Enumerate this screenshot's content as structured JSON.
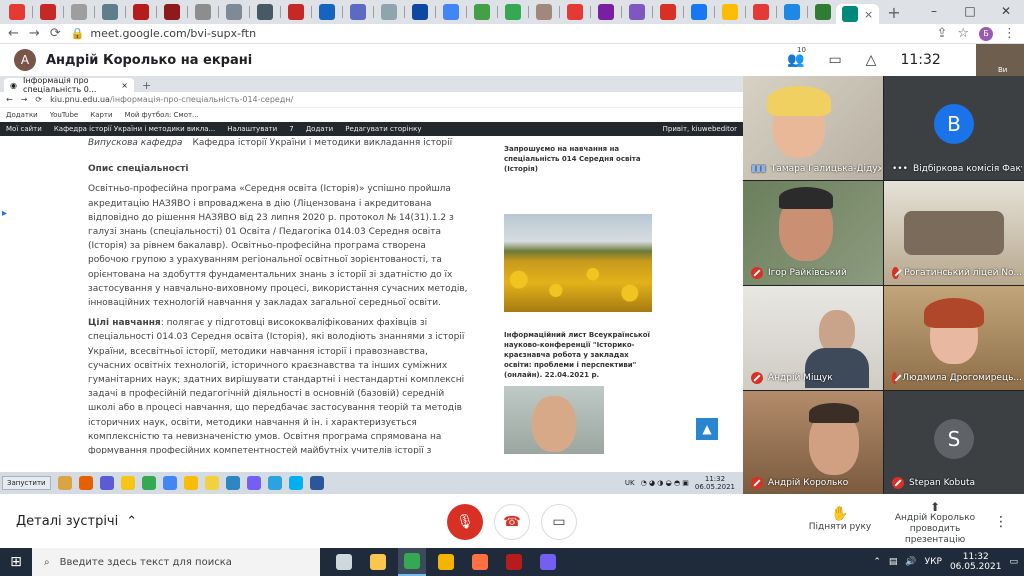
{
  "browser": {
    "url": "meet.google.com/bvi-supx-ftn",
    "profile_initial": "Б",
    "tab_close": "×",
    "new_tab": "+",
    "tab_icons": [
      {
        "name": "maps-tab-icon",
        "color": "#e53935"
      },
      {
        "name": "pdf-tab-icon",
        "color": "#c62828"
      },
      {
        "name": "globe-tab-icon",
        "color": "#9e9e9e"
      },
      {
        "name": "tab-icon-db",
        "color": "#607d8b"
      },
      {
        "name": "tab-icon-red",
        "color": "#b71c1c"
      },
      {
        "name": "tab-icon-red-2",
        "color": "#8e1b1b"
      },
      {
        "name": "tab-icon-gauge",
        "color": "#8d8d8d"
      },
      {
        "name": "tab-icon-globe",
        "color": "#7e8b97"
      },
      {
        "name": "tab-icon-ship",
        "color": "#455a64"
      },
      {
        "name": "tab-icon-shield",
        "color": "#c62828"
      },
      {
        "name": "tab-icon-lb",
        "color": "#1565c0"
      },
      {
        "name": "tab-icon-circle",
        "color": "#5c6bc0"
      },
      {
        "name": "tab-icon-ebs",
        "color": "#90a4ae"
      },
      {
        "name": "tab-icon-lb-2",
        "color": "#0d47a1"
      },
      {
        "name": "google-tab-icon",
        "color": "#4285f4"
      },
      {
        "name": "tab-icon-t",
        "color": "#43a047"
      },
      {
        "name": "google-tab-icon-2",
        "color": "#34a853"
      },
      {
        "name": "tab-icon-avatar",
        "color": "#a1887f"
      },
      {
        "name": "tab-icon-sunflower",
        "color": "#e53935"
      },
      {
        "name": "tab-icon-c",
        "color": "#7b1fa2"
      },
      {
        "name": "tab-icon-docs",
        "color": "#7e57c2"
      },
      {
        "name": "gmail-tab-icon",
        "color": "#d93025"
      },
      {
        "name": "facebook-tab-icon",
        "color": "#1877f2"
      },
      {
        "name": "google-tab-icon-3",
        "color": "#fbbc04"
      },
      {
        "name": "tab-icon-p",
        "color": "#e53935"
      },
      {
        "name": "tab-icon-bookmark",
        "color": "#1e88e5"
      },
      {
        "name": "tab-icon-g",
        "color": "#2e7d32"
      }
    ]
  },
  "meet": {
    "presenter_initial": "А",
    "presenter_title": "Андрій Королько на екрані",
    "participants_count": "10",
    "clock": "11:32",
    "selfview_label": "Ви",
    "details_label": "Деталі зустрічі",
    "raise_hand_label": "Підняти руку",
    "presenting_line1": "Андрій Королько",
    "presenting_line2": "проводить презентацію",
    "tiles": [
      {
        "name": "Тамара Галицька-Дідух",
        "status": "speaking"
      },
      {
        "name": "Відбіркова комісія Факу...",
        "status": "none",
        "initial": "B",
        "color": "#1a73e8"
      },
      {
        "name": "Ігор Райківський",
        "status": "muted"
      },
      {
        "name": "Рогатинський ліцей No...",
        "status": "muted"
      },
      {
        "name": "Андрій Міщук",
        "status": "muted"
      },
      {
        "name": "Людмила Дрогомирець...",
        "status": "muted"
      },
      {
        "name": "Андрій Королько",
        "status": "muted"
      },
      {
        "name": "Stepan Kobuta",
        "status": "muted",
        "initial": "S",
        "color": "#5f6368"
      }
    ]
  },
  "shared": {
    "tab_title": "Інформація про спеціальність 0...",
    "new_tab": "+",
    "url_host": "kiu.pnu.edu.ua",
    "url_path": "/інформація-про-спеціальність-014-середн/",
    "bookmarks": [
      "Додатки",
      "YouTube",
      "Карти",
      "Мой футбол: Смот..."
    ],
    "wp_items": [
      "Мої сайти",
      "Кафедра історії України і методики викла...",
      "Налаштувати",
      "7",
      "Додати",
      "Редагувати сторінку"
    ],
    "wp_greeting": "Привіт, kiuwebeditor",
    "dept_label": "Випускова кафедра",
    "dept_value": "Кафедра історії України і методики викладання історії",
    "desc_heading": "Опис спеціальності",
    "desc_text": "Освітньо-професійна програма «Середня освіта (Історія)» успішно пройшла акредитацію НАЗЯВО і впроваджена в дію (Ліцензована і акредитована відповідно до рішення НАЗЯВО від 23 липня 2020 р. протокол № 14(31).1.2 з галузі знань (спеціальності) 01 Освіта / Педагогіка 014.03 Середня освіта (Історія) за рівнем бакалавр). Освітньо-професійна програма створена робочою групою з урахуванням регіональної освітньої зорієнтованості, та орієнтована на здобуття фундаментальних знань з історії зі здатністю до їх застосування у навчально-виховному процесі, використання сучасних методів, інноваційних технологій навчання у закладах загальної середньої освіти.",
    "goals_label": "Цілі навчання",
    "goals_text": ": полягає у підготовці висококваліфікованих фахівців зі спеціальності 014.03 Середня освіта (Історія), які володіють знаннями з історії України, всесвітньої історії, методики навчання історії і правознавства, сучасних освітніх технологій, історичного краєзнавства та інших суміжних гуманітарних наук; здатних вирішувати стандартні і нестандартні комплексні задачі в професійній педагогічній діяльності в основній (базовій) середній школі або в процесі навчання, що передбачає застосування теорій та методів історичних наук, освіти, методики навчання й ін. і характеризується комплексністю та невизначеністю умов. Освітня програма спрямована на формування професійних компетентностей майбутніх учителів історії з фаховими інтересами до впровадження інноваційних технологій з метою безперервного подальшого навчання та підвищення професійного рівня, що забезпечить високий рівень їх конкурентоспроможності та затребуваності на ринку праці; виховання високоморальних,",
    "side_text1": "Запрошуємо на навчання на спеціальність 014 Середня освіта (Історія)",
    "side_text2": "Інформаційний лист Всеукраїнської науково-конференції \"Історико-краєзнавча робота у закладах освіти: проблеми і перспективи\" (онлайн). 22.04.2021 р.",
    "taskbar_start": "Запустити",
    "taskbar_lang": "UK",
    "taskbar_time": "11:32",
    "taskbar_date": "06.05.2021"
  },
  "taskbar": {
    "search_placeholder": "Введите здесь текст для поиска",
    "lang": "УКР",
    "time": "11:32",
    "date": "06.05.2021",
    "apps": [
      {
        "name": "task-view-app",
        "color": "#cfd8dc"
      },
      {
        "name": "file-explorer-app",
        "color": "#f9c74f"
      },
      {
        "name": "chrome-app",
        "color": "#34a853"
      },
      {
        "name": "folder-app",
        "color": "#f4b400"
      },
      {
        "name": "orange-app",
        "color": "#ff7043"
      },
      {
        "name": "filezilla-app",
        "color": "#b71c1c"
      },
      {
        "name": "viber-app",
        "color": "#7360f2"
      }
    ]
  }
}
